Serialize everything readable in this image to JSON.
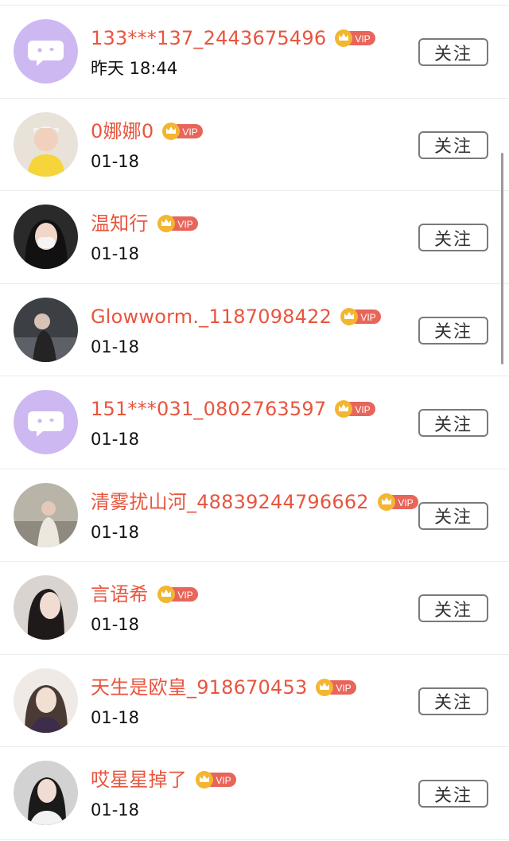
{
  "follow_label": "关注",
  "vip_label": "VIP",
  "colors": {
    "name": "#e8553f",
    "vip_badge": "#e8655a",
    "crown": "#f3b630",
    "default_avatar_bg": "#cdb8f2"
  },
  "users": [
    {
      "name": "133***137_2443675496",
      "date": "昨天 18:44",
      "avatar": "default-avatar",
      "vip": true
    },
    {
      "name": "0娜娜0",
      "date": "01-18",
      "avatar": "user-photo",
      "vip": true
    },
    {
      "name": "温知行",
      "date": "01-18",
      "avatar": "user-photo",
      "vip": true
    },
    {
      "name": "Glowworm._1187098422",
      "date": "01-18",
      "avatar": "user-photo",
      "vip": true
    },
    {
      "name": "151***031_0802763597",
      "date": "01-18",
      "avatar": "default-avatar",
      "vip": true
    },
    {
      "name": "清雾扰山河_48839244796662",
      "date": "01-18",
      "avatar": "user-photo",
      "vip": true
    },
    {
      "name": "言语希",
      "date": "01-18",
      "avatar": "user-photo",
      "vip": true
    },
    {
      "name": "天生是欧皇_918670453",
      "date": "01-18",
      "avatar": "user-photo",
      "vip": true
    },
    {
      "name": "哎星星掉了",
      "date": "01-18",
      "avatar": "user-photo",
      "vip": true
    }
  ]
}
